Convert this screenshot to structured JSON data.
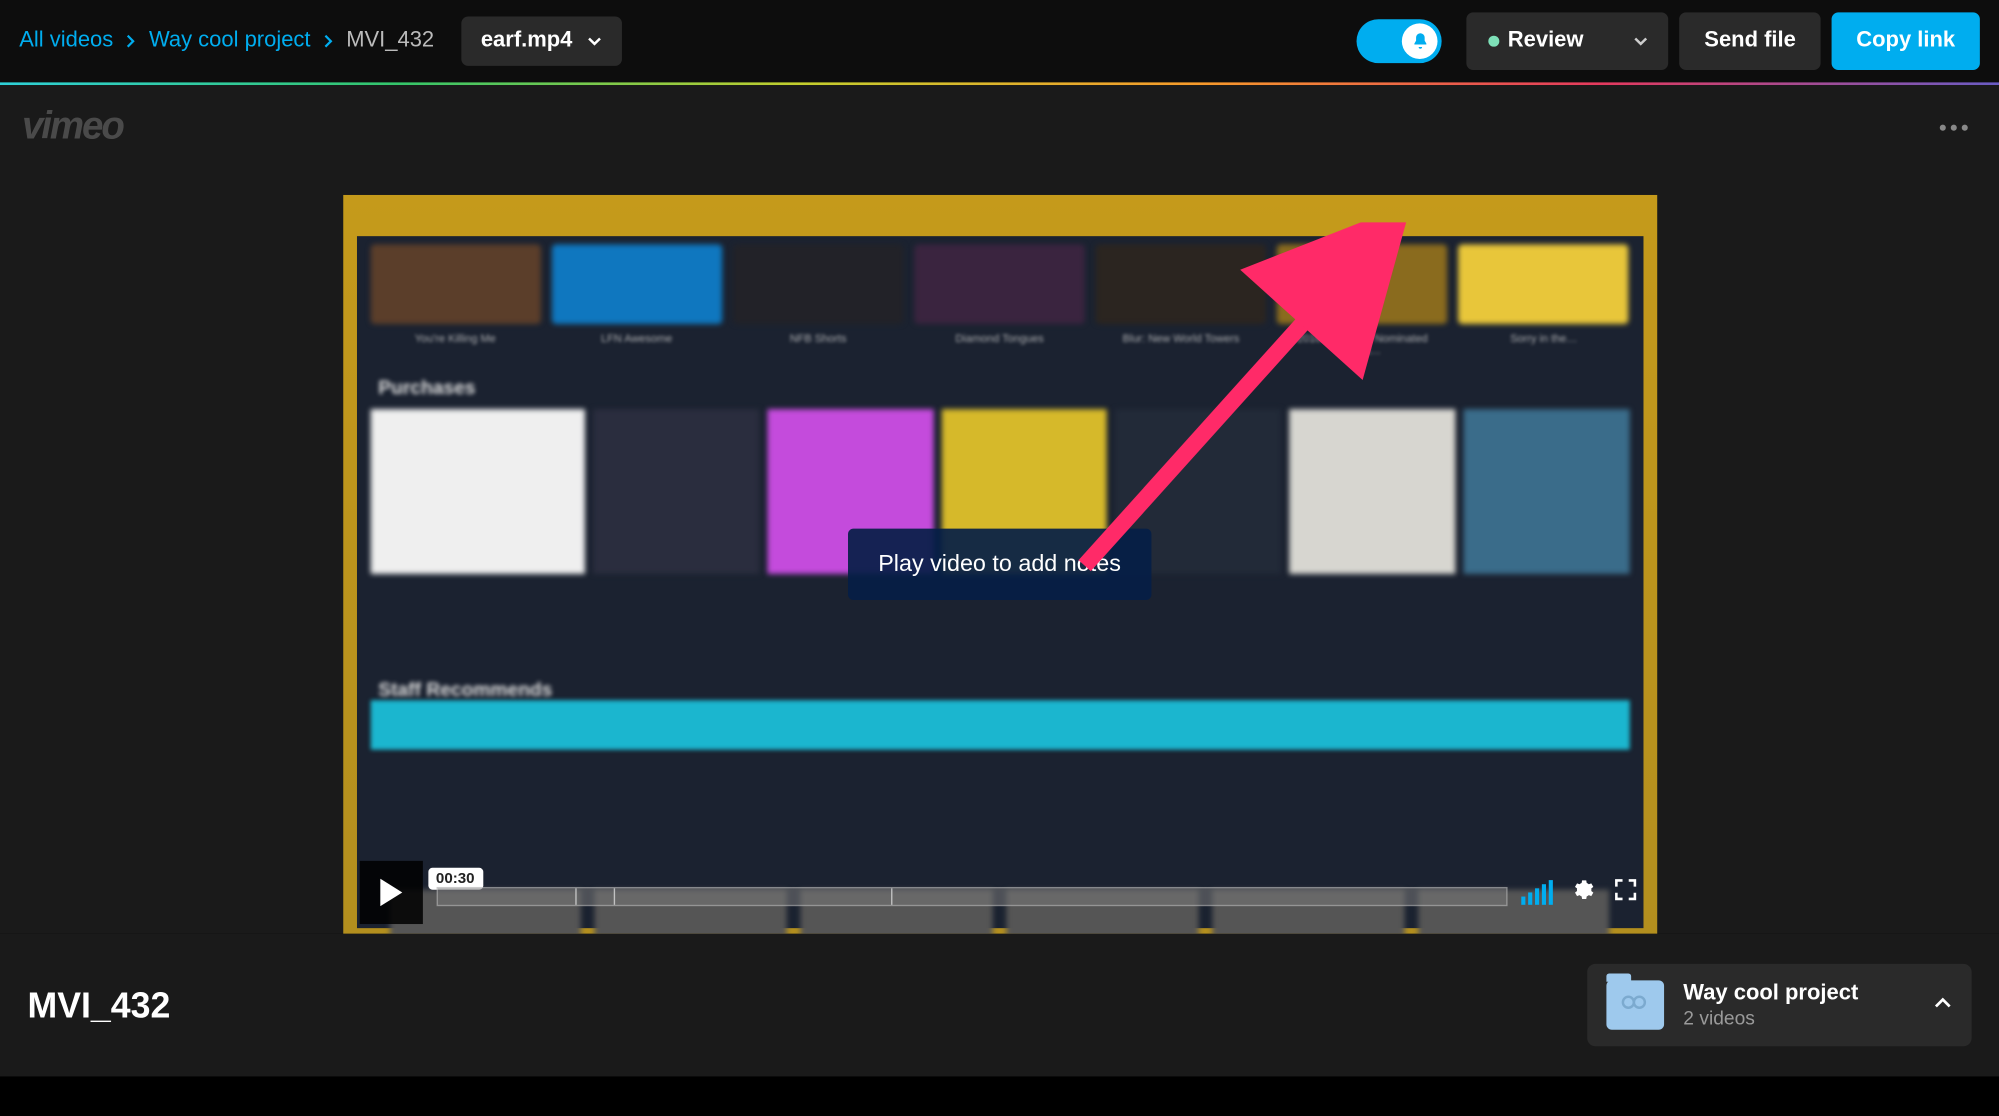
{
  "breadcrumb": {
    "root": "All videos",
    "project": "Way cool project",
    "item": "MVI_432",
    "file": "earf.mp4"
  },
  "header": {
    "review_label": "Review",
    "send_file_label": "Send file",
    "copy_link_label": "Copy link"
  },
  "logo": "vimeo",
  "player": {
    "overlay_message": "Play video to add notes",
    "time_tip": "00:30"
  },
  "footer": {
    "title": "MVI_432",
    "project_name": "Way cool project",
    "project_count": "2 videos"
  },
  "thumb_row1_labels": [
    "You're Killing Me",
    "LFN Awesome",
    "NFB Shorts",
    "Diamond Tongues",
    "Blur: New World Towers",
    "2016 OSCAR® Nominated Short…",
    "Sorry in the…"
  ],
  "thumb_row1_colors": [
    "#5b3e2a",
    "#0f77bf",
    "#222228",
    "#3a243f",
    "#2b2520",
    "#8a6b1e",
    "#e8c63a"
  ],
  "section_purchases": "Purchases",
  "section_staff": "Staff Recommends",
  "row2_colors": [
    "#efefef",
    "#2a2d3e",
    "#c44bdc",
    "#d6b92a",
    "#222a38",
    "#d7d6d0",
    "#3a6c8a"
  ]
}
